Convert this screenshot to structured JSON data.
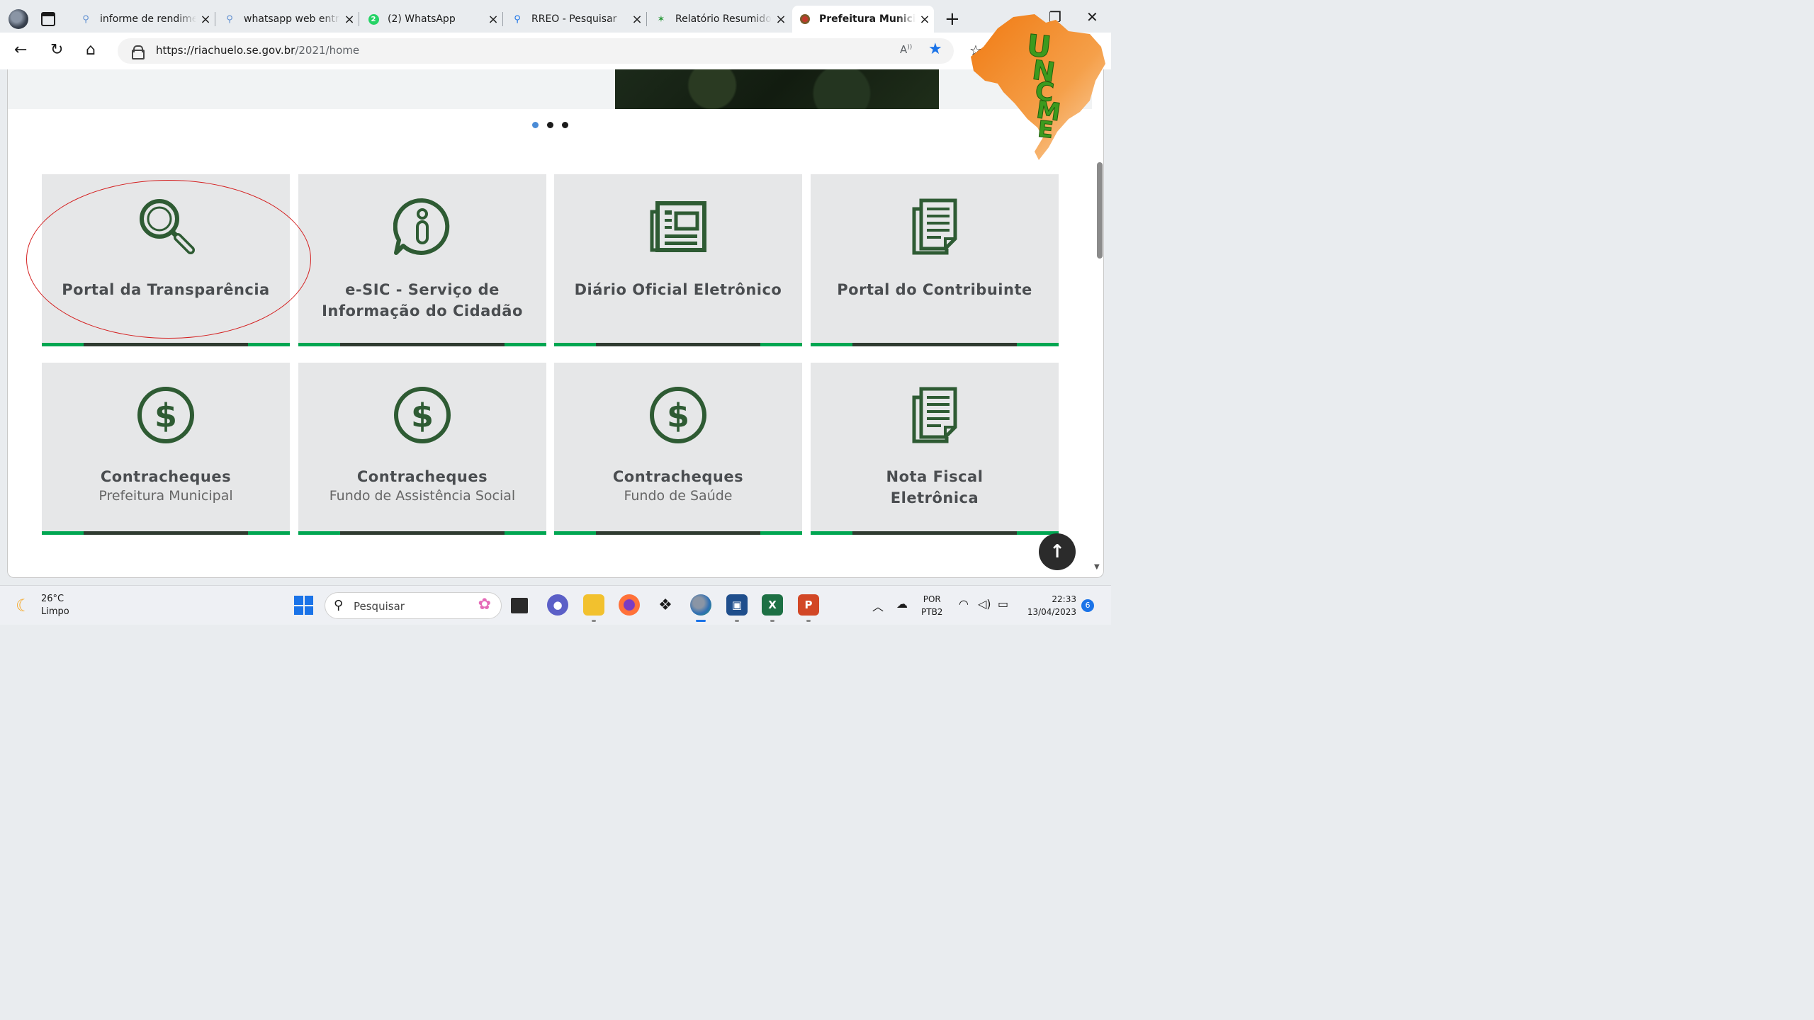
{
  "browser": {
    "tabs": [
      {
        "title": "informe de rendimen",
        "favicon": "search-icon"
      },
      {
        "title": "whatsapp web entrar",
        "favicon": "search-icon"
      },
      {
        "title": "(2) WhatsApp",
        "favicon": "whatsapp-icon",
        "badge": "2"
      },
      {
        "title": "RREO - Pesquisar",
        "favicon": "search-icon"
      },
      {
        "title": "Relatório Resumido d",
        "favicon": "palm-icon"
      },
      {
        "title": "Prefeitura Municipal",
        "favicon": "site-icon",
        "active": true
      }
    ],
    "new_tab": "+",
    "url_host": "https://riachuelo.se.gov.br",
    "url_path": "/2021/home",
    "read_aloud": "A̅ᴬ"
  },
  "page": {
    "carousel_dots": 3,
    "carousel_active": 0,
    "cards": [
      {
        "title": "Portal da Transparência",
        "subtitle": "",
        "icon": "magnifier-icon"
      },
      {
        "title": "e-SIC - Serviço de Informação do Cidadão",
        "subtitle": "",
        "icon": "info-chat-icon"
      },
      {
        "title": "Diário Oficial Eletrônico",
        "subtitle": "",
        "icon": "newspaper-icon"
      },
      {
        "title": "Portal do Contribuinte",
        "subtitle": "",
        "icon": "documents-icon"
      },
      {
        "title": "Contracheques",
        "subtitle": "Prefeitura Municipal",
        "icon": "dollar-icon"
      },
      {
        "title": "Contracheques",
        "subtitle": "Fundo de Assistência Social",
        "icon": "dollar-icon"
      },
      {
        "title": "Contracheques",
        "subtitle": "Fundo de Saúde",
        "icon": "dollar-icon"
      },
      {
        "title": "Nota Fiscal Eletrônica",
        "subtitle": "",
        "icon": "documents-icon"
      }
    ],
    "back_to_top": "↑",
    "accent_color": "#00a651",
    "icon_color": "#2e5b33",
    "highlight_color": "#d42020"
  },
  "logo_text": "UNCME",
  "taskbar": {
    "temperature": "26°C",
    "weather": "Limpo",
    "search_placeholder": "Pesquisar",
    "lang_1": "POR",
    "lang_2": "PTB2",
    "time": "22:33",
    "date": "13/04/2023",
    "notifications": "6"
  }
}
